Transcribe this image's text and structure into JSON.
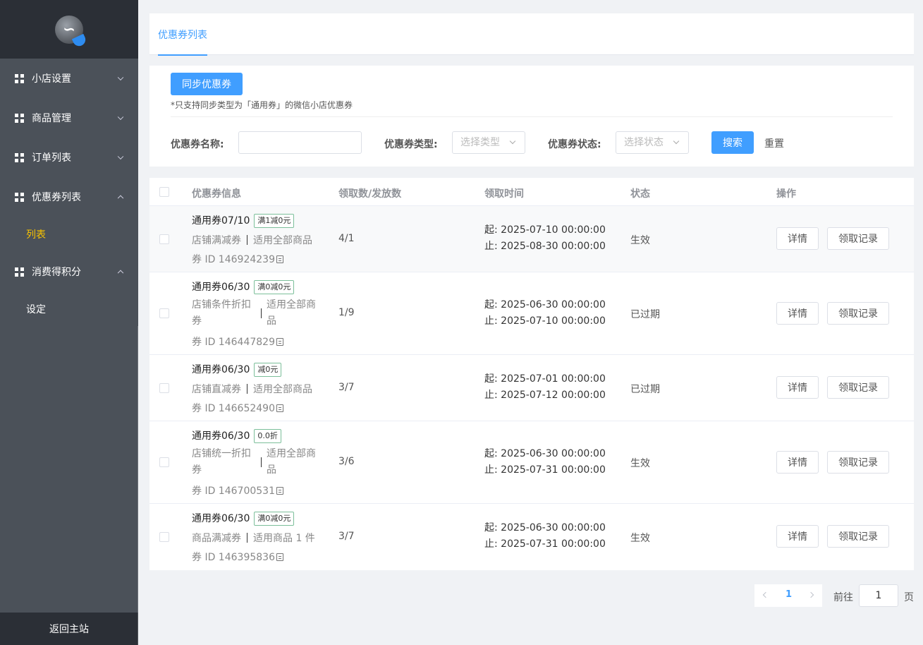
{
  "sidebar": {
    "logo_glyph": "∽",
    "menu": [
      {
        "label": "小店设置",
        "arrow": "down"
      },
      {
        "label": "商品管理",
        "arrow": "down"
      },
      {
        "label": "订单列表",
        "arrow": "down"
      },
      {
        "label": "优惠券列表",
        "arrow": "up"
      },
      {
        "label": "消费得积分",
        "arrow": "up"
      }
    ],
    "submenu_coupon": "列表",
    "submenu_points": "设定",
    "footer": "返回主站"
  },
  "tabs": {
    "active": "优惠券列表"
  },
  "toolbar": {
    "sync_label": "同步优惠券",
    "sync_note": "*只支持同步类型为「通用券」的微信小店优惠券"
  },
  "filters": {
    "name_label": "优惠券名称:",
    "name_value": "",
    "type_label": "优惠券类型:",
    "type_placeholder": "选择类型",
    "status_label": "优惠券状态:",
    "status_placeholder": "选择状态",
    "search_label": "搜索",
    "reset_label": "重置"
  },
  "table": {
    "headers": [
      "优惠券信息",
      "领取数/发放数",
      "领取时间",
      "状态",
      "操作"
    ],
    "rows": [
      {
        "name": "通用券07/10",
        "tag": "满1减0元",
        "type": "店铺满减券",
        "scope": "适用全部商品",
        "id": "券 ID 146924239",
        "count": "4/1",
        "start": "起: 2025-07-10 00:00:00",
        "end": "止: 2025-08-30 00:00:00",
        "status": "生效",
        "detail": "详情",
        "records": "领取记录"
      },
      {
        "name": "通用券06/30",
        "tag": "满0减0元",
        "type": "店铺条件折扣券",
        "scope": "适用全部商品",
        "type_l1": "店铺条件折扣",
        "type_l2": "券",
        "scope_l1": "适用全部商",
        "scope_l2": "品",
        "id": "券 ID 146447829",
        "count": "1/9",
        "start": "起: 2025-06-30 00:00:00",
        "end": "止: 2025-07-10 00:00:00",
        "status": "已过期",
        "detail": "详情",
        "records": "领取记录"
      },
      {
        "name": "通用券06/30",
        "tag": "减0元",
        "type": "店铺直减券",
        "scope": "适用全部商品",
        "id": "券 ID 146652490",
        "count": "3/7",
        "start": "起: 2025-07-01 00:00:00",
        "end": "止: 2025-07-12 00:00:00",
        "status": "已过期",
        "detail": "详情",
        "records": "领取记录"
      },
      {
        "name": "通用券06/30",
        "tag": "0.0折",
        "type": "店铺统一折扣券",
        "scope": "适用全部商品",
        "type_l1": "店铺统一折扣",
        "type_l2": "券",
        "scope_l1": "适用全部商",
        "scope_l2": "品",
        "id": "券 ID 146700531",
        "count": "3/6",
        "start": "起: 2025-06-30 00:00:00",
        "end": "止: 2025-07-31 00:00:00",
        "status": "生效",
        "detail": "详情",
        "records": "领取记录"
      },
      {
        "name": "通用券06/30",
        "tag": "满0减0元",
        "type": "商品满减券",
        "scope": "适用商品 1 件",
        "id": "券 ID 146395836",
        "count": "3/7",
        "start": "起: 2025-06-30 00:00:00",
        "end": "止: 2025-07-31 00:00:00",
        "status": "生效",
        "detail": "详情",
        "records": "领取记录"
      }
    ]
  },
  "pagination": {
    "current_page": "1",
    "goto_label": "前往",
    "goto_value": "1",
    "goto_suffix": "页"
  },
  "colors": {
    "accent": "#409eff",
    "sidebar": "#4b5159",
    "sidebar_dark": "#2b2f36",
    "active_submenu": "#f7c200"
  }
}
